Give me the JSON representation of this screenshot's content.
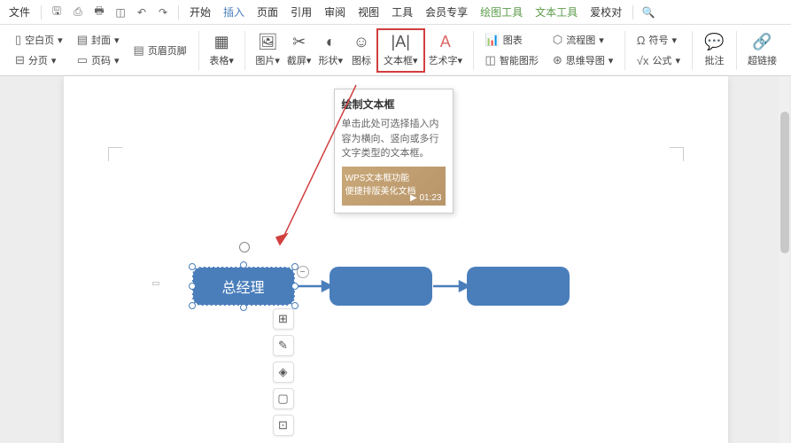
{
  "menubar": {
    "file": "文件",
    "tabs": [
      "开始",
      "插入",
      "页面",
      "引用",
      "审阅",
      "视图",
      "工具",
      "会员专享",
      "绘图工具",
      "文本工具",
      "爱校对"
    ],
    "activeIndex": 1,
    "greenIndexes": [
      8,
      9
    ]
  },
  "ribbon": {
    "blank": "空白页",
    "section": "分页",
    "cover": "封面",
    "pagenum": "页码",
    "headerfooter": "页眉页脚",
    "table": "表格",
    "picture": "图片",
    "screenshot": "截屏",
    "shapes": "形状",
    "icons": "图标",
    "textbox": "文本框",
    "wordart": "艺术字",
    "chart": "图表",
    "smartart": "智能图形",
    "flowchart": "流程图",
    "mindmap": "思维导图",
    "symbol": "符号",
    "formula": "公式",
    "comment": "批注",
    "hyperlink": "超链接"
  },
  "tooltip": {
    "title": "绘制文本框",
    "desc": "单击此处可选择插入内容为横向、竖向或多行文字类型的文本框。",
    "promo1": "WPS文本框功能",
    "promo2": "便捷排版美化文档",
    "time": "01:23"
  },
  "shapes": {
    "label1": "总经理"
  },
  "marginMark": "▣"
}
